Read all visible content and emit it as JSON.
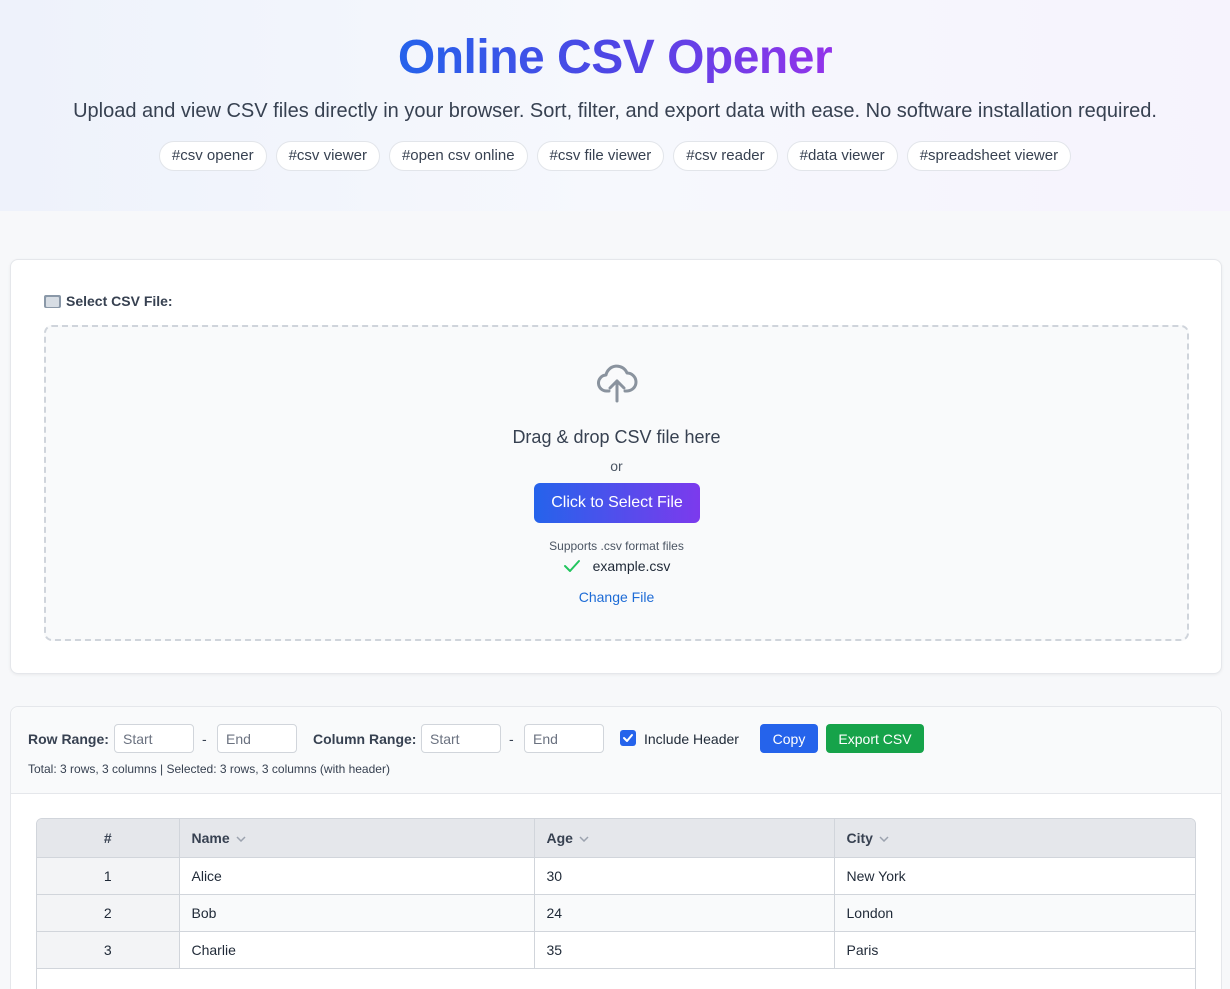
{
  "hero": {
    "title": "Online CSV Opener",
    "subtitle": "Upload and view CSV files directly in your browser. Sort, filter, and export data with ease. No software installation required.",
    "tags": [
      "#csv opener",
      "#csv viewer",
      "#open csv online",
      "#csv file viewer",
      "#csv reader",
      "#data viewer",
      "#spreadsheet viewer"
    ]
  },
  "upload": {
    "label": "Select CSV File:",
    "label_icon": "folder-icon",
    "drop_icon": "cloud-upload-icon",
    "drop_title": "Drag & drop CSV file here",
    "or_text": "or",
    "select_button": "Click to Select File",
    "support_text": "Supports .csv format files",
    "file_name": "example.csv",
    "file_status_icon": "check-icon",
    "change_link": "Change File"
  },
  "toolbar": {
    "row_range_label": "Row Range:",
    "column_range_label": "Column Range:",
    "start_placeholder": "Start",
    "end_placeholder": "End",
    "dash": "-",
    "include_header_label": "Include Header",
    "include_header_checked": true,
    "copy_label": "Copy",
    "export_label": "Export CSV",
    "summary": "Total: 3 rows, 3 columns | Selected: 3 rows, 3 columns (with header)"
  },
  "table": {
    "index_header": "#",
    "columns": [
      "Name",
      "Age",
      "City"
    ],
    "rows": [
      [
        "1",
        "Alice",
        "30",
        "New York"
      ],
      [
        "2",
        "Bob",
        "24",
        "London"
      ],
      [
        "3",
        "Charlie",
        "35",
        "Paris"
      ]
    ]
  },
  "colors": {
    "brand_blue": "#2563eb",
    "brand_purple": "#9333ea",
    "export_green": "#16a34a",
    "success_check": "#22c55e",
    "link": "#1d6bd6"
  }
}
